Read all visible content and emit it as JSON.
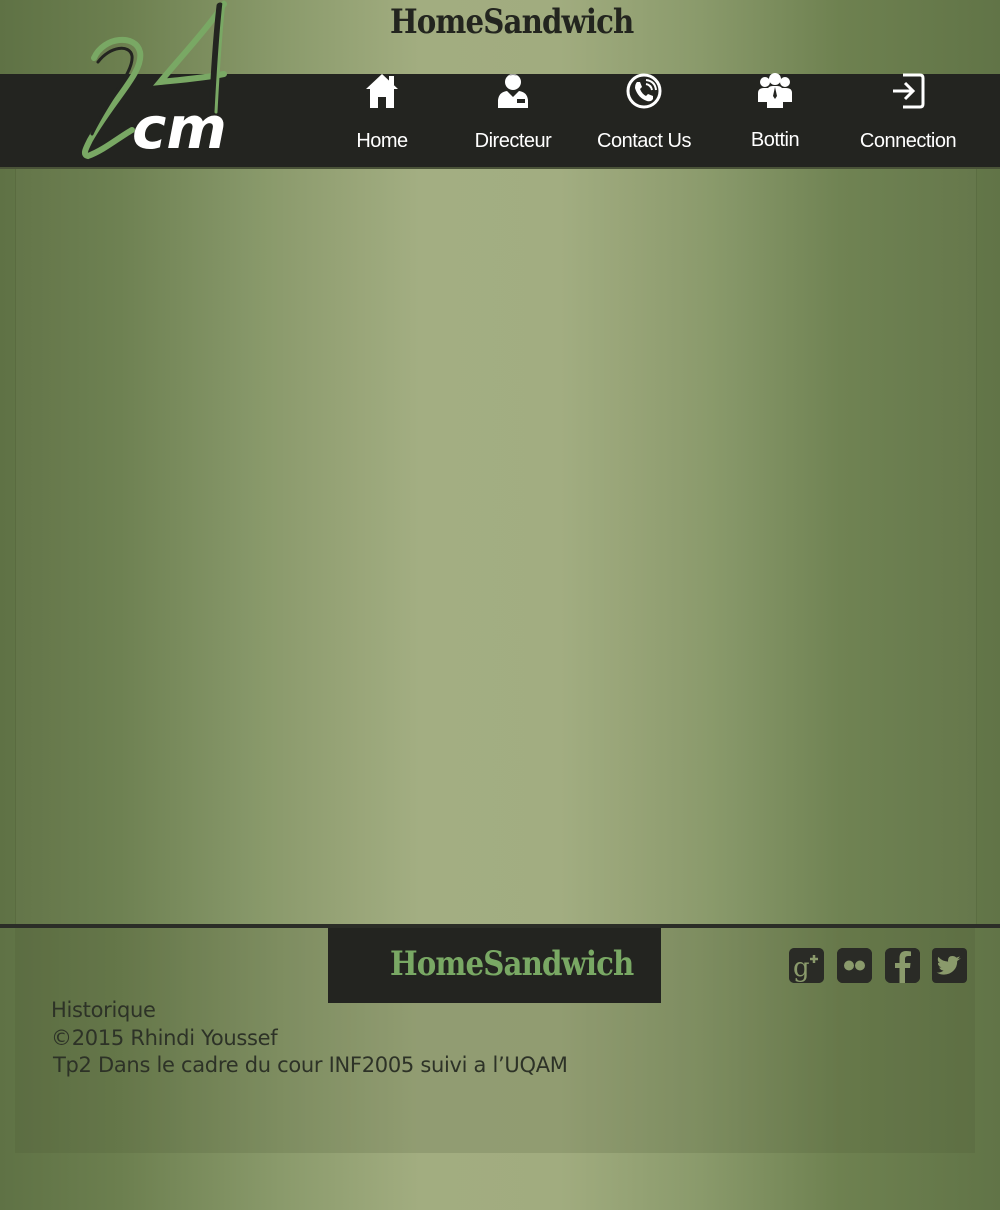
{
  "header": {
    "site_title": "HomeSandwich",
    "logo_text": "cm",
    "logo_alt": "24cm"
  },
  "nav": {
    "items": [
      {
        "label": "Home",
        "icon": "home-icon"
      },
      {
        "label": "Directeur",
        "icon": "director-icon"
      },
      {
        "label": "Contact Us",
        "icon": "phone-icon"
      },
      {
        "label": "Bottin",
        "icon": "people-icon"
      },
      {
        "label": "Connection",
        "icon": "login-icon"
      }
    ]
  },
  "footer": {
    "brand": "HomeSandwich",
    "lines": [
      "Historique",
      "©2015 Rhindi Youssef",
      "Tp2  Dans le cadre du cour INF2005 suivi a l’UQAM"
    ],
    "social": [
      {
        "name": "google-plus",
        "icon": "google-plus-icon"
      },
      {
        "name": "flickr",
        "icon": "flickr-icon"
      },
      {
        "name": "facebook",
        "icon": "facebook-icon"
      },
      {
        "name": "twitter",
        "icon": "twitter-icon"
      }
    ]
  },
  "colors": {
    "nav_background": "#232420",
    "brand_green": "#79a864",
    "title_dark": "#23251f"
  }
}
